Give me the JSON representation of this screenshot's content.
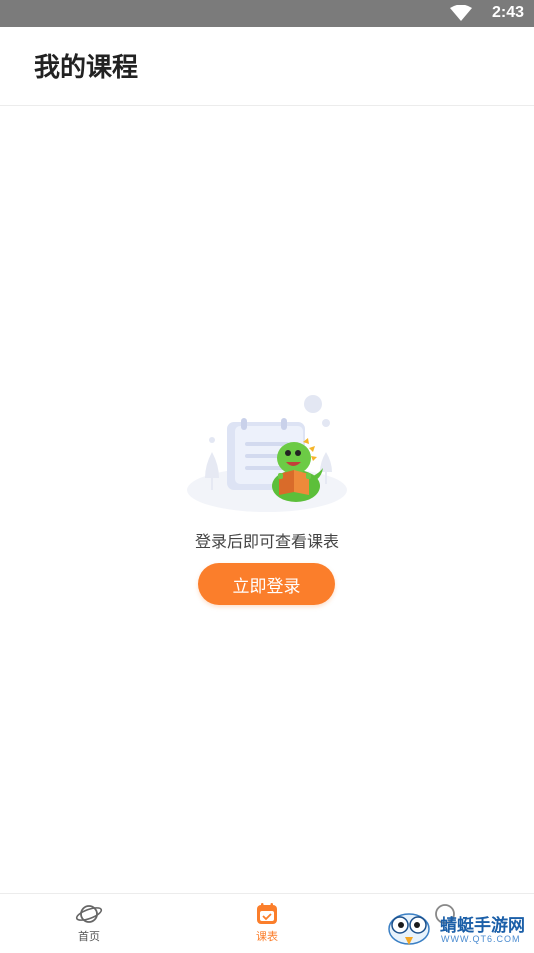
{
  "status_bar": {
    "time": "2:43",
    "wifi_icon": "wifi-icon"
  },
  "header": {
    "title": "我的课程"
  },
  "empty_state": {
    "illustration": "dinosaur-reading-calendar-illustration",
    "message": "登录后即可查看课表",
    "login_button": "立即登录"
  },
  "tabbar": {
    "items": [
      {
        "label": "首页",
        "icon": "planet-icon",
        "active": false
      },
      {
        "label": "课表",
        "icon": "calendar-icon",
        "active": true
      },
      {
        "label": "",
        "icon": "profile-icon",
        "active": false
      }
    ]
  },
  "watermark": {
    "title": "蜻蜓手游网",
    "subtitle": "WWW.QT6.COM"
  },
  "colors": {
    "accent": "#fb7e2b",
    "status_bar": "#7b7b7b",
    "text": "#222222"
  }
}
